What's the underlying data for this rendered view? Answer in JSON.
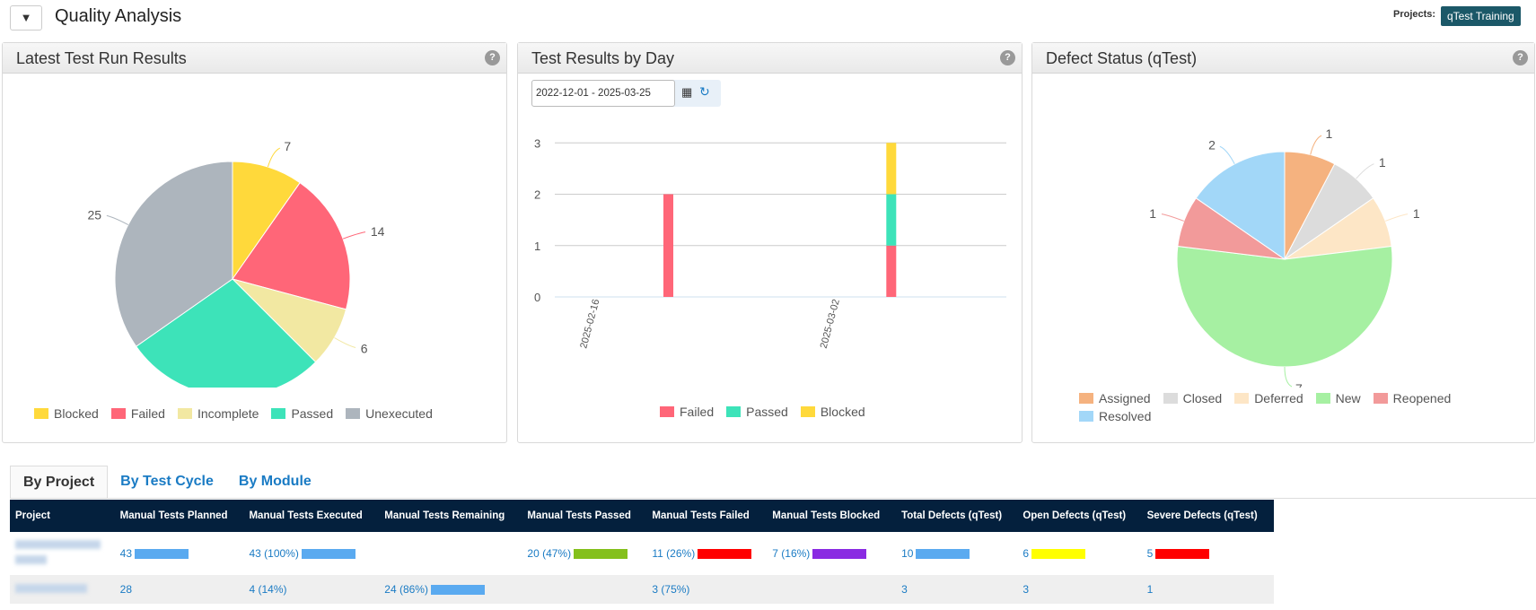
{
  "header": {
    "title": "Quality Analysis",
    "filter_icon": "filter-icon",
    "projects_label": "Projects:",
    "project": "qTest Training"
  },
  "colors": {
    "blocked": "#ffd93b",
    "failed": "#ff6678",
    "incomplete": "#f2e8a2",
    "passed": "#3de3b9",
    "unexecuted": "#adb5bd",
    "assigned": "#f5b27f",
    "closed": "#dcdcdc",
    "deferred": "#fde6c6",
    "new": "#a6f0a2",
    "reopened": "#f29a9a",
    "resolved": "#a2d7f8"
  },
  "panels": {
    "latest": {
      "title": "Latest Test Run Results",
      "help": "?"
    },
    "byday": {
      "title": "Test Results by Day",
      "help": "?",
      "date_range": "2022-12-01 - 2025-03-25"
    },
    "defects": {
      "title": "Defect Status (qTest)",
      "help": "?"
    }
  },
  "chart_data": [
    {
      "type": "pie",
      "labels": [
        "Blocked",
        "Failed",
        "Incomplete",
        "Passed",
        "Unexecuted"
      ],
      "values": [
        7,
        14,
        6,
        20,
        25
      ],
      "legend": "bottom"
    },
    {
      "type": "bar",
      "stacked": true,
      "x": [
        "2025-02-21",
        "2025-03-06"
      ],
      "xticks": [
        "2025-02-16",
        "2025-03-02"
      ],
      "ylim": [
        0,
        4
      ],
      "yticks": [
        "0",
        "1",
        "2",
        "3",
        "4"
      ],
      "grid": true,
      "legend": "bottom",
      "series": [
        {
          "name": "Failed",
          "values": [
            2,
            1
          ]
        },
        {
          "name": "Passed",
          "values": [
            0,
            1
          ]
        },
        {
          "name": "Blocked",
          "values": [
            0,
            1
          ]
        }
      ]
    },
    {
      "type": "pie",
      "labels": [
        "Assigned",
        "Closed",
        "Deferred",
        "New",
        "Reopened",
        "Resolved"
      ],
      "values": [
        1,
        1,
        1,
        7,
        1,
        2
      ],
      "legend": "bottom"
    }
  ],
  "tabs": [
    "By Project",
    "By Test Cycle",
    "By Module"
  ],
  "table": {
    "headers": [
      "Project",
      "Manual Tests Planned",
      "Manual Tests Executed",
      "Manual Tests Remaining",
      "Manual Tests Passed",
      "Manual Tests Failed",
      "Manual Tests Blocked",
      "Total Defects (qTest)",
      "Open Defects (qTest)",
      "Severe Defects (qTest)"
    ],
    "rows": [
      [
        "",
        "43",
        "43 (100%)",
        "",
        "20 (47%)",
        "11 (26%)",
        "7 (16%)",
        "10",
        "6",
        "5"
      ],
      [
        "",
        "28",
        "4 (14%)",
        "24 (86%)",
        "",
        "3 (75%)",
        "",
        "3",
        "3",
        "1"
      ]
    ],
    "bar_colors": [
      "#5aaaf0",
      "#5aaaf0",
      "#5aaaf0",
      "#84c01c",
      "#ff0000",
      "#8a2be2",
      "#5aaaf0",
      "#ffff00",
      "#ff0000"
    ]
  }
}
